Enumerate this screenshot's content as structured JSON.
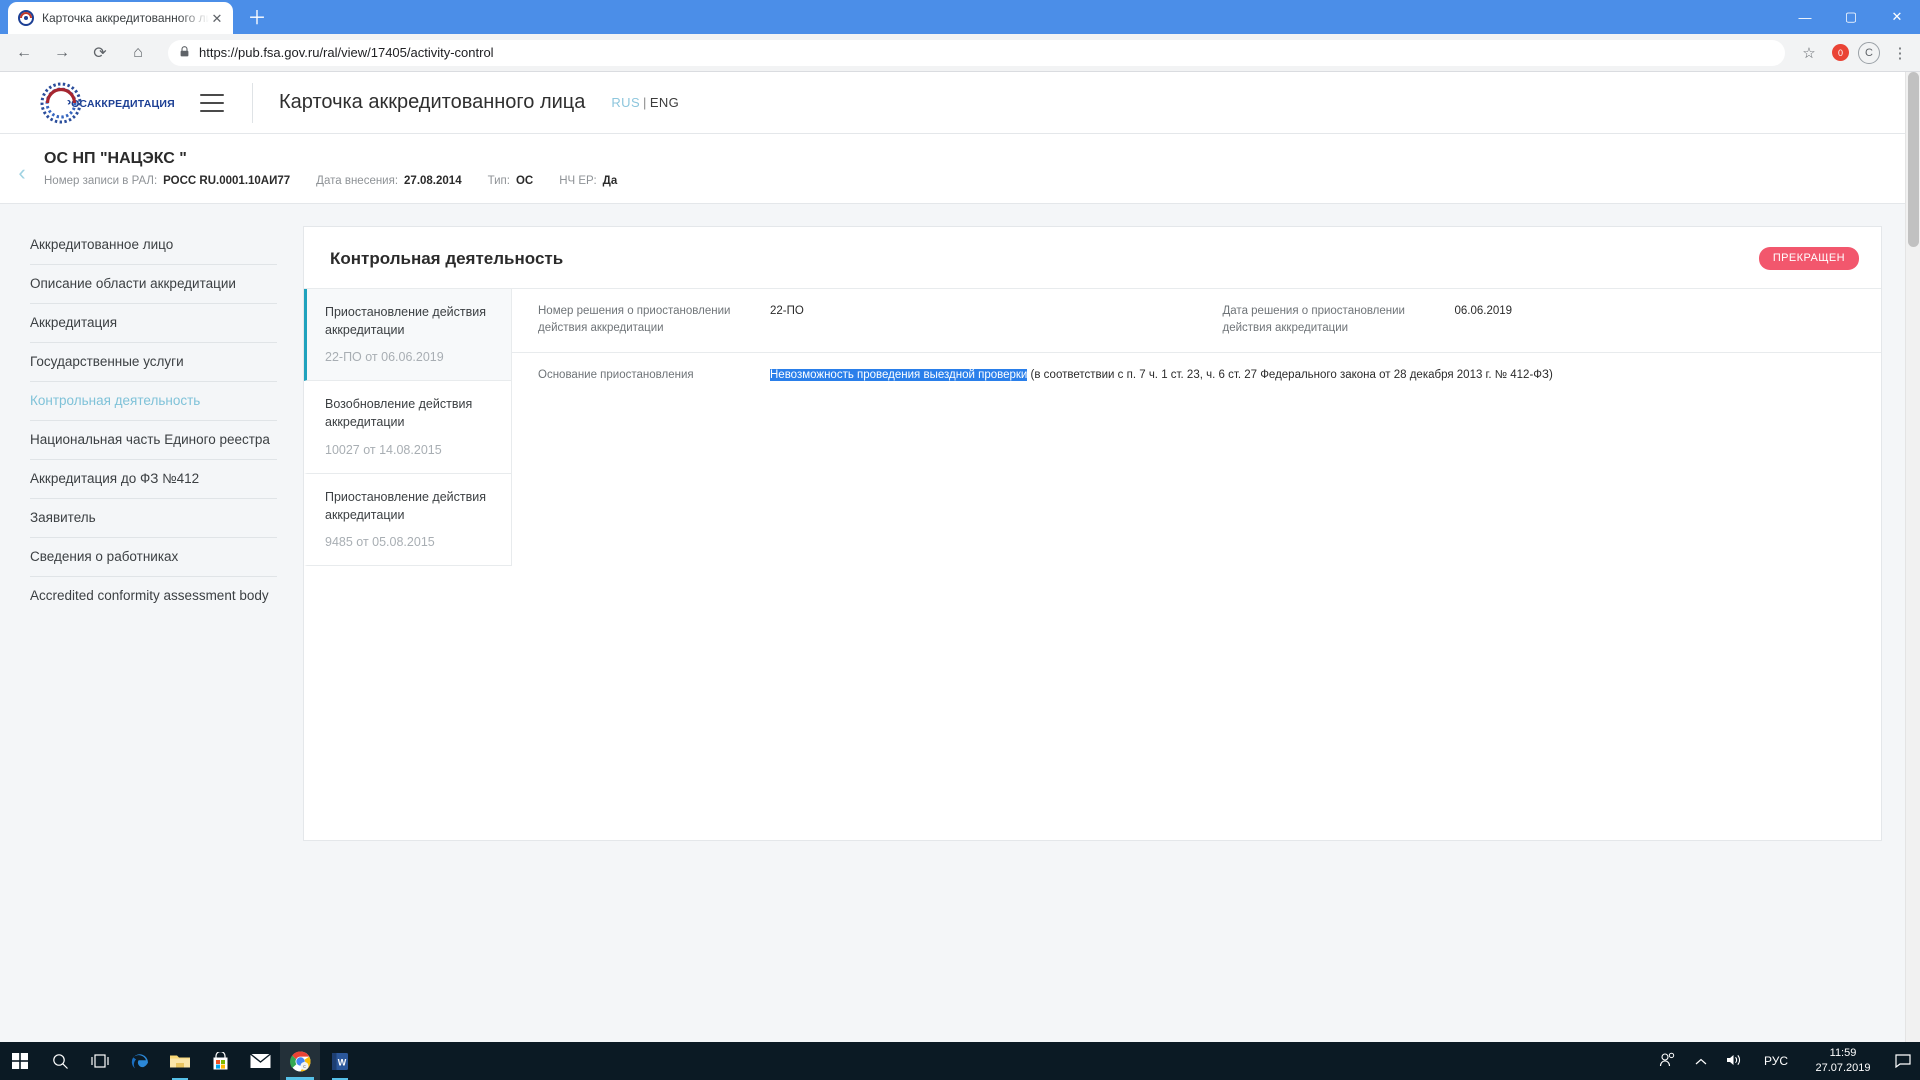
{
  "browser": {
    "tab": {
      "title": "Карточка аккредитованного ли",
      "favicon_name": "rosakkreditatsiya-favicon",
      "close_label": "✕"
    },
    "new_tab_label": "＋",
    "window_controls": {
      "minimize": "—",
      "maximize": "▢",
      "close": "✕"
    },
    "toolbar": {
      "back": "←",
      "forward": "→",
      "reload": "⟳",
      "home": "⌂",
      "lock": "🔒",
      "url": "https://pub.fsa.gov.ru/ral/view/17405/activity-control",
      "star": "☆",
      "extension_badge": "0",
      "profile": "C",
      "menu": "⋮"
    }
  },
  "header": {
    "logo_text": "РОСАККРЕДИТАЦИЯ",
    "title": "Карточка аккредитованного лица",
    "lang": {
      "rus": "RUS",
      "sep": "|",
      "eng": "ENG"
    }
  },
  "record": {
    "back": "‹",
    "title": "ОС НП \"НАЦЭКС \"",
    "meta": [
      {
        "label": "Номер записи в РАЛ:",
        "value": "РОСС RU.0001.10АИ77"
      },
      {
        "label": "Дата внесения:",
        "value": "27.08.2014"
      },
      {
        "label": "Тип:",
        "value": "ОС"
      },
      {
        "label": "НЧ ЕР:",
        "value": "Да"
      }
    ]
  },
  "sidebar": {
    "items": [
      {
        "label": "Аккредитованное лицо",
        "active": false
      },
      {
        "label": "Описание области аккредитации",
        "active": false
      },
      {
        "label": "Аккредитация",
        "active": false
      },
      {
        "label": "Государственные услуги",
        "active": false
      },
      {
        "label": "Контрольная деятельность",
        "active": true
      },
      {
        "label": "Национальная часть Единого реестра",
        "active": false
      },
      {
        "label": "Аккредитация до ФЗ №412",
        "active": false
      },
      {
        "label": "Заявитель",
        "active": false
      },
      {
        "label": "Сведения о работниках",
        "active": false
      },
      {
        "label": "Accredited conformity assessment body",
        "active": false
      }
    ]
  },
  "card": {
    "title": "Контрольная деятельность",
    "status_badge": "ПРЕКРАЩЕН",
    "badge_color": "#f2576d",
    "decisions": [
      {
        "name": "Приостановление действия аккредитации",
        "number": "22-ПО от 06.06.2019",
        "selected": true
      },
      {
        "name": "Возобновление действия аккредитации",
        "number": "10027 от 14.08.2015",
        "selected": false
      },
      {
        "name": "Приостановление действия аккредитации",
        "number": "9485 от 05.08.2015",
        "selected": false
      }
    ],
    "detail": {
      "number_label": "Номер решения о приостановлении действия аккредитации",
      "number_value": "22-ПО",
      "date_label": "Дата решения о приостановлении действия аккредитации",
      "date_value": "06.06.2019",
      "reason_label": "Основание приостановления",
      "reason_selected_text": "Невозможность проведения выездной проверки",
      "reason_rest_text": " (в соответствии с п. 7 ч. 1 ст. 23, ч. 6 ст. 27 Федерального закона от 28 декабря 2013 г. № 412-ФЗ)"
    }
  },
  "taskbar": {
    "items": [
      {
        "name": "start-button",
        "glyph": "start",
        "state": "idle"
      },
      {
        "name": "search-button",
        "glyph": "search",
        "state": "idle"
      },
      {
        "name": "task-view-button",
        "glyph": "taskview",
        "state": "idle"
      },
      {
        "name": "edge-button",
        "glyph": "edge",
        "state": "idle"
      },
      {
        "name": "file-explorer-button",
        "glyph": "explorer",
        "state": "running"
      },
      {
        "name": "microsoft-store-button",
        "glyph": "store",
        "state": "idle"
      },
      {
        "name": "mail-button",
        "glyph": "mail",
        "state": "idle"
      },
      {
        "name": "chrome-button",
        "glyph": "chrome",
        "state": "active"
      },
      {
        "name": "word-button",
        "glyph": "word",
        "state": "running"
      }
    ],
    "tray": {
      "people": "people-icon",
      "chevron": "⌃",
      "volume": "volume-icon",
      "language": "РУС",
      "time": "11:59",
      "date": "27.07.2019",
      "notifications": "notification-icon"
    }
  }
}
